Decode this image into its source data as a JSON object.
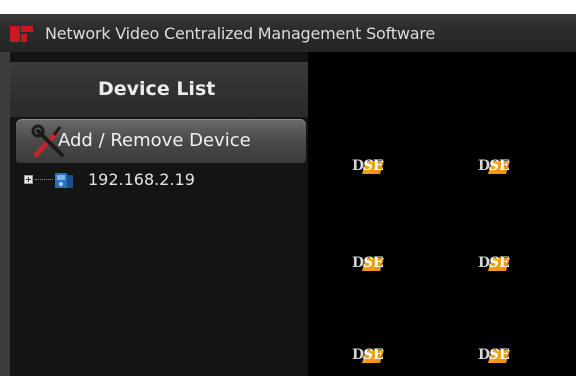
{
  "window": {
    "title": "Network Video Centralized Management Software"
  },
  "sidebar": {
    "header": "Device List",
    "add_remove_label": "Add / Remove Device",
    "tree": [
      {
        "label": "192.168.2.19",
        "icon": "camera-device-icon",
        "expander": "plus"
      }
    ]
  },
  "video": {
    "tiles": [
      {
        "logo": "DSE"
      },
      {
        "logo": "DSE"
      },
      {
        "logo": "DSE"
      },
      {
        "logo": "DSE"
      },
      {
        "logo": "DSE"
      },
      {
        "logo": "DSE"
      }
    ]
  },
  "colors": {
    "background": "#000000",
    "panel": "#141414",
    "header": "#2a2a2a",
    "logo_accent": "#f3b21a"
  }
}
